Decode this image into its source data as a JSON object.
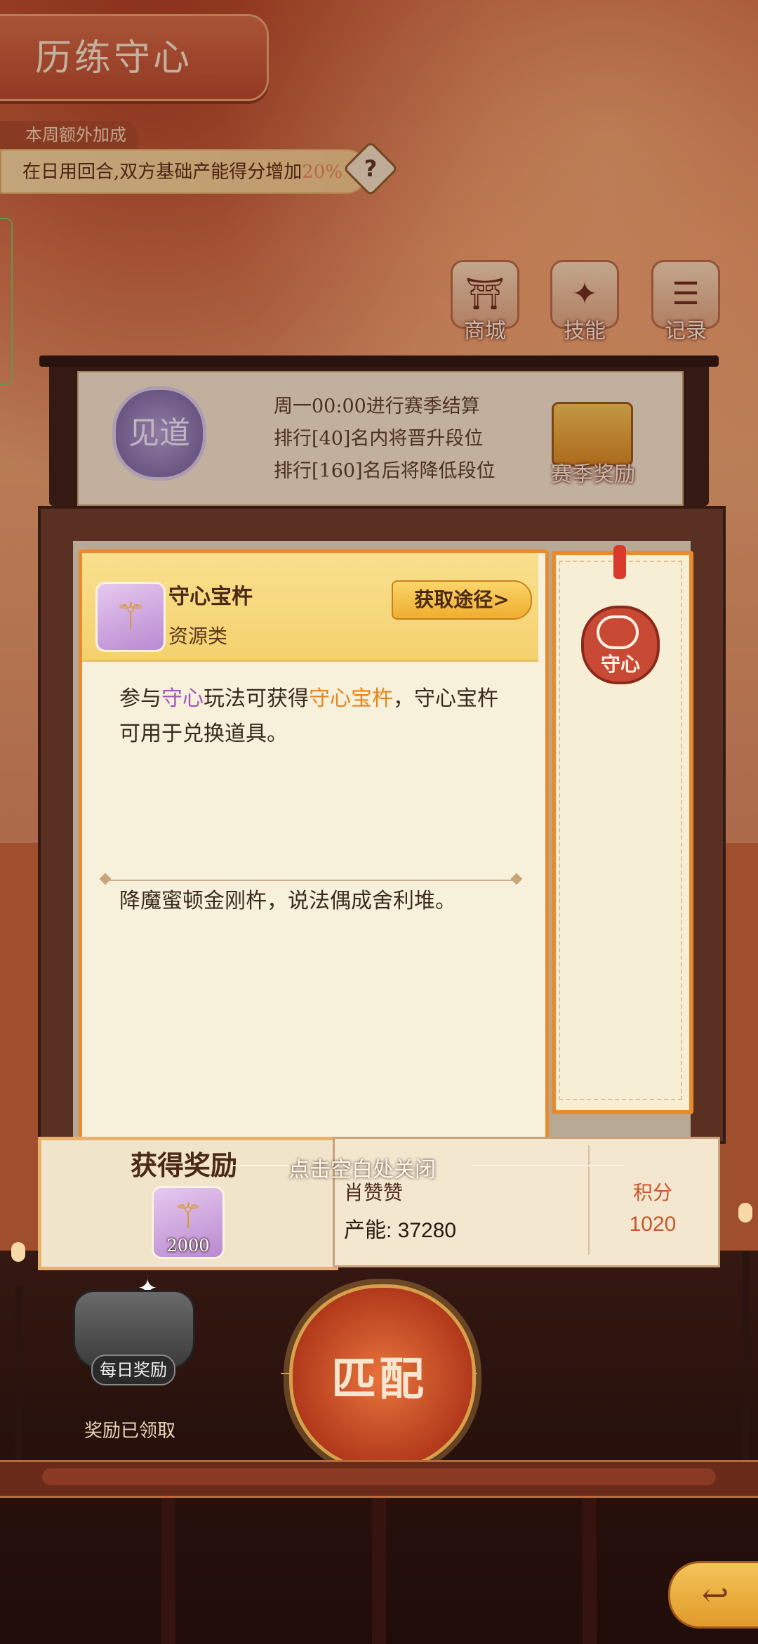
{
  "header": {
    "title": "历练守心"
  },
  "weekly_bonus": {
    "tag": "本周额外加成",
    "text": "在日用回合,双方基础产能得分增加",
    "percent": "20%",
    "help_glyph": "?"
  },
  "top_buttons": [
    {
      "label": "商城",
      "icon": "shop-icon",
      "glyph": "⛩"
    },
    {
      "label": "技能",
      "icon": "skill-icon",
      "glyph": "✦"
    },
    {
      "label": "记录",
      "icon": "record-icon",
      "glyph": "☰"
    }
  ],
  "season": {
    "rank_badge": "见道",
    "lines": [
      "周一00:00进行赛季结算",
      "排行[40]名内将晋升段位",
      "排行[160]名后将降低段位"
    ],
    "reward_label": "赛季奖励"
  },
  "item_card": {
    "name": "守心宝杵",
    "category": "资源类",
    "get_button": "获取途径>",
    "icon_glyph": "⚚",
    "desc_parts": [
      "参与",
      "守心",
      "玩法可获得",
      "守心宝杵",
      "，守心宝杵可用于兑换道具。"
    ],
    "poem": "降魔蜜顿金刚杵，说法偶成舍利堆。"
  },
  "bookmark": {
    "seal_text": "守心"
  },
  "close_hint": "点击空白处关闭",
  "reward": {
    "title": "获得奖励",
    "item_count": "2000"
  },
  "player": {
    "name": "肖赞赞",
    "power": "产能: 37280",
    "score_label": "积分",
    "score": "1020"
  },
  "daily": {
    "label": "每日奖励",
    "status": "奖励已领取"
  },
  "match_button": "匹配",
  "back_glyph": "↩",
  "colors": {
    "accent_orange": "#e88a2e",
    "highlight_purple": "#a256b8",
    "highlight_orange": "#e5851e",
    "score_red": "#c8582e"
  }
}
